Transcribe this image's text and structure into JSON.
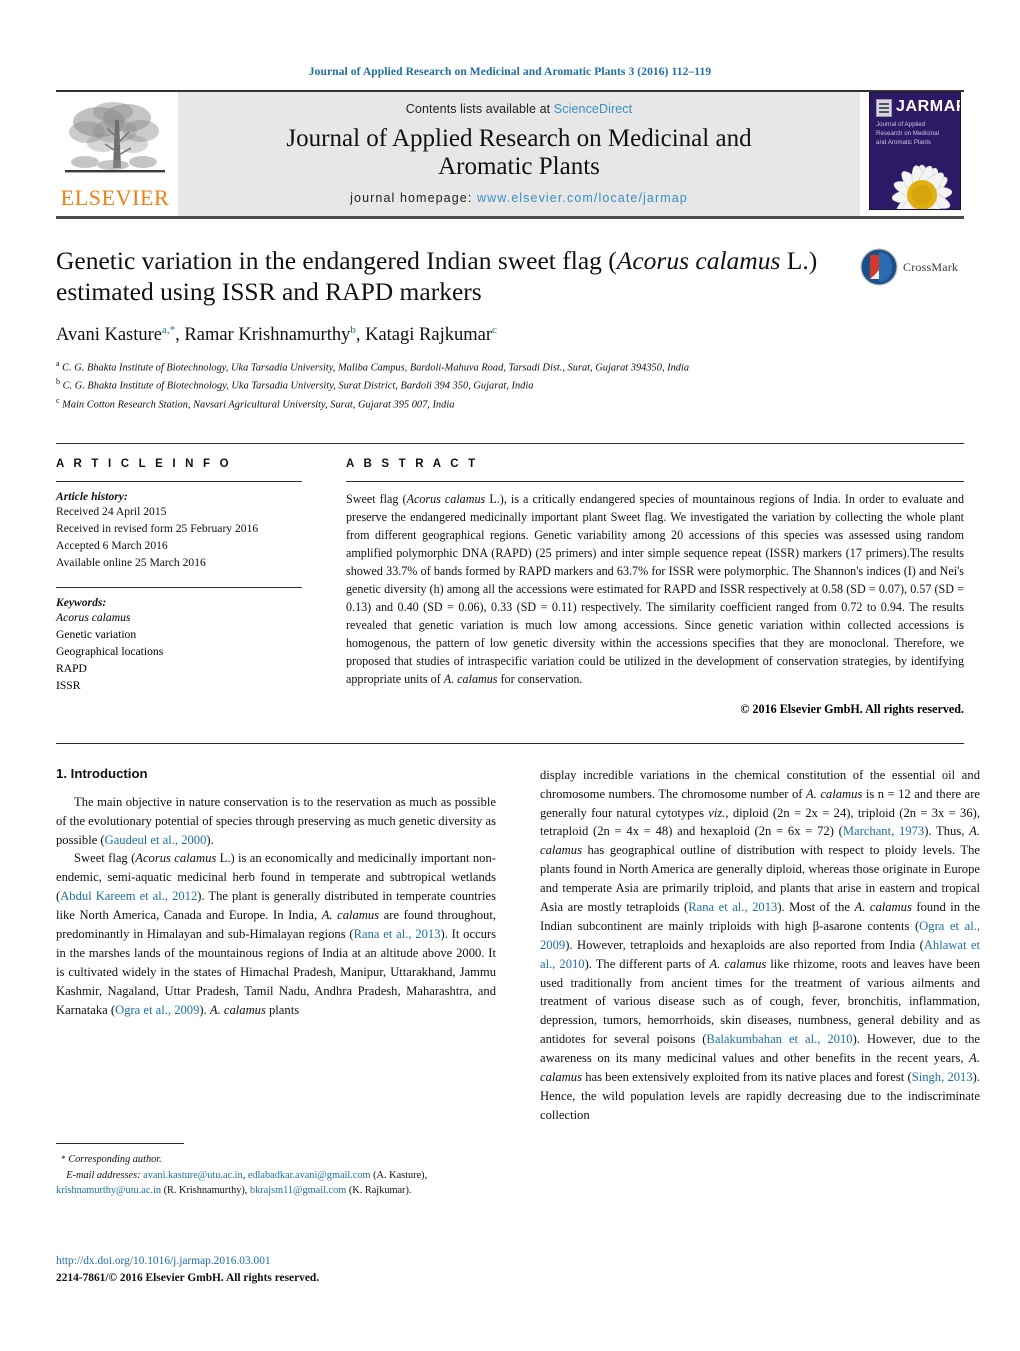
{
  "running_head": "Journal of Applied Research on Medicinal and Aromatic Plants 3 (2016) 112–119",
  "masthead": {
    "publisher_name": "ELSEVIER",
    "contents_prefix": "Contents lists available at ",
    "contents_link": "ScienceDirect",
    "journal_title": "Journal of Applied Research on Medicinal and Aromatic Plants",
    "homepage_label": "journal homepage: ",
    "homepage_url": "www.elsevier.com/locate/jarmap",
    "cover": {
      "acronym": "JARMAP",
      "subtitle": "Journal of Applied Research on Medicinal and Aromatic Plants"
    },
    "colors": {
      "link_blue": "#3a8fc4",
      "elsevier_orange": "#f07e13",
      "cover_purple": "#2c1a66",
      "band_gray": "#e7e7e7"
    }
  },
  "article": {
    "title_part1": "Genetic variation in the endangered Indian sweet flag (",
    "title_italic1": "Acorus calamus",
    "title_part2": " L.) estimated using ISSR and RAPD markers",
    "crossmark_label": "CrossMark",
    "authors": [
      {
        "name": "Avani Kasture",
        "marks": "a,*"
      },
      {
        "name": "Ramar Krishnamurthy",
        "marks": "b"
      },
      {
        "name": "Katagi Rajkumar",
        "marks": "c"
      }
    ],
    "affiliations": [
      {
        "mark": "a",
        "text": "C. G. Bhakta Institute of Biotechnology, Uka Tarsadia University, Maliba Campus, Bardoli-Mahuva Road, Tarsadi Dist., Surat, Gujarat 394350, India"
      },
      {
        "mark": "b",
        "text": "C. G. Bhakta Institute of Biotechnology, Uka Tarsadia University, Surat District, Bardoli 394 350, Gujarat, India"
      },
      {
        "mark": "c",
        "text": "Main Cotton Research Station, Navsari Agricultural University, Surat, Gujarat 395 007, India"
      }
    ]
  },
  "article_info": {
    "heading": "A R T I C L E   I N F O",
    "history_label": "Article history:",
    "history": [
      "Received 24 April 2015",
      "Received in revised form 25 February 2016",
      "Accepted 6 March 2016",
      "Available online 25 March 2016"
    ],
    "keywords_label": "Keywords:",
    "keywords": [
      {
        "text": "Acorus calamus",
        "italic": true
      },
      {
        "text": "Genetic variation",
        "italic": false
      },
      {
        "text": "Geographical locations",
        "italic": false
      },
      {
        "text": "RAPD",
        "italic": false
      },
      {
        "text": "ISSR",
        "italic": false
      }
    ]
  },
  "abstract": {
    "heading": "A B S T R A C T",
    "segments": [
      {
        "t": "Sweet flag (",
        "i": false
      },
      {
        "t": "Acorus calamus",
        "i": true
      },
      {
        "t": " L.), is a critically endangered species of mountainous regions of India. In order to evaluate and preserve the endangered medicinally important plant Sweet flag. We investigated the variation by collecting the whole plant from different geographical regions. Genetic variability among 20 accessions of this species was assessed using random amplified polymorphic DNA (RAPD) (25 primers) and inter simple sequence repeat (ISSR) markers (17 primers).The results showed 33.7% of bands formed by RAPD markers and 63.7% for ISSR were polymorphic. The Shannon's indices (I) and Nei's genetic diversity (h) among all the accessions were estimated for RAPD and ISSR respectively at 0.58 (SD = 0.07), 0.57 (SD = 0.13) and 0.40 (SD = 0.06), 0.33 (SD = 0.11) respectively. The similarity coefficient ranged from 0.72 to 0.94. The results revealed that genetic variation is much low among accessions. Since genetic variation within collected accessions is homogenous, the pattern of low genetic diversity within the accessions specifies that they are monoclonal. Therefore, we proposed that studies of intraspecific variation could be utilized in the development of conservation strategies, by identifying appropriate units of ",
        "i": false
      },
      {
        "t": "A. calamus",
        "i": true
      },
      {
        "t": " for conservation.",
        "i": false
      }
    ],
    "copyright": "© 2016 Elsevier GmbH. All rights reserved."
  },
  "body": {
    "section_heading": "1.  Introduction",
    "left_paragraphs": [
      [
        {
          "t": "The main objective in nature conservation is to the reservation as much as possible of the evolutionary potential of species through preserving as much genetic diversity as possible (",
          "k": "plain"
        },
        {
          "t": "Gaudeul et al., 2000",
          "k": "ref"
        },
        {
          "t": ").",
          "k": "plain"
        }
      ],
      [
        {
          "t": "Sweet flag (",
          "k": "plain"
        },
        {
          "t": "Acorus calamus",
          "k": "ital"
        },
        {
          "t": " L.) is an economically and medicinally important non-endemic, semi-aquatic medicinal herb found in temperate and subtropical wetlands (",
          "k": "plain"
        },
        {
          "t": "Abdul Kareem et al., 2012",
          "k": "ref"
        },
        {
          "t": "). The plant is generally distributed in temperate countries like North America, Canada and Europe. In India, ",
          "k": "plain"
        },
        {
          "t": "A. calamus",
          "k": "ital"
        },
        {
          "t": " are found throughout, predominantly in Himalayan and sub-Himalayan regions (",
          "k": "plain"
        },
        {
          "t": "Rana et al., 2013",
          "k": "ref"
        },
        {
          "t": "). It occurs in the marshes lands of the mountainous regions of India at an altitude above 2000. It is cultivated widely in the states of Himachal Pradesh, Manipur, Uttarakhand, Jammu Kashmir, Nagaland, Uttar Pradesh, Tamil Nadu, Andhra Pradesh, Maharashtra, and Karnataka (",
          "k": "plain"
        },
        {
          "t": "Ogra et al., 2009",
          "k": "ref"
        },
        {
          "t": "). ",
          "k": "plain"
        },
        {
          "t": "A. calamus",
          "k": "ital"
        },
        {
          "t": " plants",
          "k": "plain"
        }
      ]
    ],
    "right_paragraphs": [
      [
        {
          "t": "display incredible variations in the chemical constitution of the essential oil and chromosome numbers. The chromosome number of ",
          "k": "plain"
        },
        {
          "t": "A. calamus",
          "k": "ital"
        },
        {
          "t": " is n = 12 and there are generally four natural cytotypes ",
          "k": "plain"
        },
        {
          "t": "viz.",
          "k": "ital"
        },
        {
          "t": ", diploid (2n = 2x = 24), triploid (2n = 3x = 36), tetraploid (2n = 4x = 48) and hexaploid (2n = 6x = 72) (",
          "k": "plain"
        },
        {
          "t": "Marchant, 1973",
          "k": "ref"
        },
        {
          "t": "). Thus, ",
          "k": "plain"
        },
        {
          "t": "A. calamus",
          "k": "ital"
        },
        {
          "t": " has geographical outline of distribution with respect to ploidy levels. The plants found in North America are generally diploid, whereas those originate in Europe and temperate Asia are primarily triploid, and plants that arise in eastern and tropical Asia are mostly tetraploids (",
          "k": "plain"
        },
        {
          "t": "Rana et al., 2013",
          "k": "ref"
        },
        {
          "t": "). Most of the ",
          "k": "plain"
        },
        {
          "t": "A. calamus",
          "k": "ital"
        },
        {
          "t": " found in the Indian subcontinent are mainly triploids with high β-asarone contents (",
          "k": "plain"
        },
        {
          "t": "Ogra et al., 2009",
          "k": "ref"
        },
        {
          "t": "). However, tetraploids and hexaploids are also reported from India (",
          "k": "plain"
        },
        {
          "t": "Ahlawat et al., 2010",
          "k": "ref"
        },
        {
          "t": "). The different parts of ",
          "k": "plain"
        },
        {
          "t": "A. calamus",
          "k": "ital"
        },
        {
          "t": " like rhizome, roots and leaves have been used traditionally from ancient times for the treatment of various ailments and treatment of various disease such as of cough, fever, bronchitis, inflammation, depression, tumors, hemorrhoids, skin diseases, numbness, general debility and as antidotes for several poisons (",
          "k": "plain"
        },
        {
          "t": "Balakumbahan et al., 2010",
          "k": "ref"
        },
        {
          "t": "). However, due to the awareness on its many medicinal values and other benefits in the recent years, ",
          "k": "plain"
        },
        {
          "t": "A. calamus",
          "k": "ital"
        },
        {
          "t": " has been extensively exploited from its native places and forest (",
          "k": "plain"
        },
        {
          "t": "Singh, 2013",
          "k": "ref"
        },
        {
          "t": "). Hence, the wild population levels are rapidly decreasing due to the indiscriminate collection",
          "k": "plain"
        }
      ]
    ]
  },
  "footnote": {
    "corresponding": "Corresponding author.",
    "email_label": "E-mail addresses:",
    "emails": [
      {
        "mail": "avani.kasture@utu.ac.in",
        "sep": ", "
      },
      {
        "mail": "edlabadkar.avani@gmail.com",
        "sep": " "
      }
    ],
    "owner1": "(A. Kasture), ",
    "mail3": "krishnamurthy@utu.ac.in",
    "owner2": " (R. Krishnamurthy), ",
    "mail4": "bkrajsm11@gmail.com",
    "owner3": " (K. Rajkumar).",
    "doi": "http://dx.doi.org/10.1016/j.jarmap.2016.03.001",
    "issn": "2214-7861/© 2016 Elsevier GmbH. All rights reserved."
  }
}
